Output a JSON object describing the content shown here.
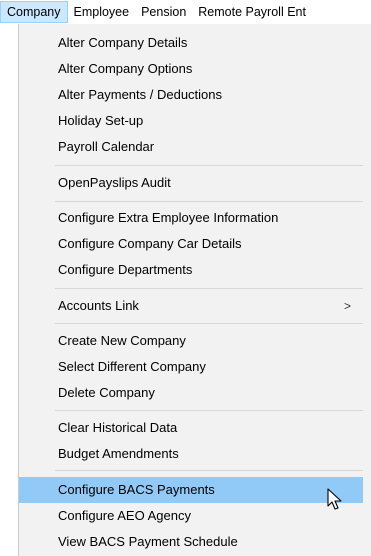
{
  "menubar": {
    "items": [
      {
        "label": "Company",
        "active": true
      },
      {
        "label": "Employee",
        "active": false
      },
      {
        "label": "Pension",
        "active": false
      },
      {
        "label": "Remote Payroll Ent",
        "active": false
      }
    ]
  },
  "menu": {
    "items": [
      {
        "label": "Alter Company Details"
      },
      {
        "label": "Alter Company Options"
      },
      {
        "label": "Alter Payments / Deductions"
      },
      {
        "label": "Holiday Set-up"
      },
      {
        "label": "Payroll Calendar"
      },
      {
        "label": "OpenPayslips Audit"
      },
      {
        "label": "Configure Extra Employee Information"
      },
      {
        "label": "Configure Company Car Details"
      },
      {
        "label": "Configure Departments"
      },
      {
        "label": "Accounts Link",
        "submenu_arrow": ">"
      },
      {
        "label": "Create New Company"
      },
      {
        "label": "Select Different Company"
      },
      {
        "label": "Delete Company"
      },
      {
        "label": "Clear Historical Data"
      },
      {
        "label": "Budget Amendments"
      },
      {
        "label": "Configure BACS Payments",
        "highlighted": true
      },
      {
        "label": "Configure AEO Agency"
      },
      {
        "label": "View BACS Payment Schedule"
      }
    ]
  },
  "colors": {
    "menu_background": "#f2f2f2",
    "highlight": "#91c9f7",
    "menubar_active": "#cce8ff"
  }
}
